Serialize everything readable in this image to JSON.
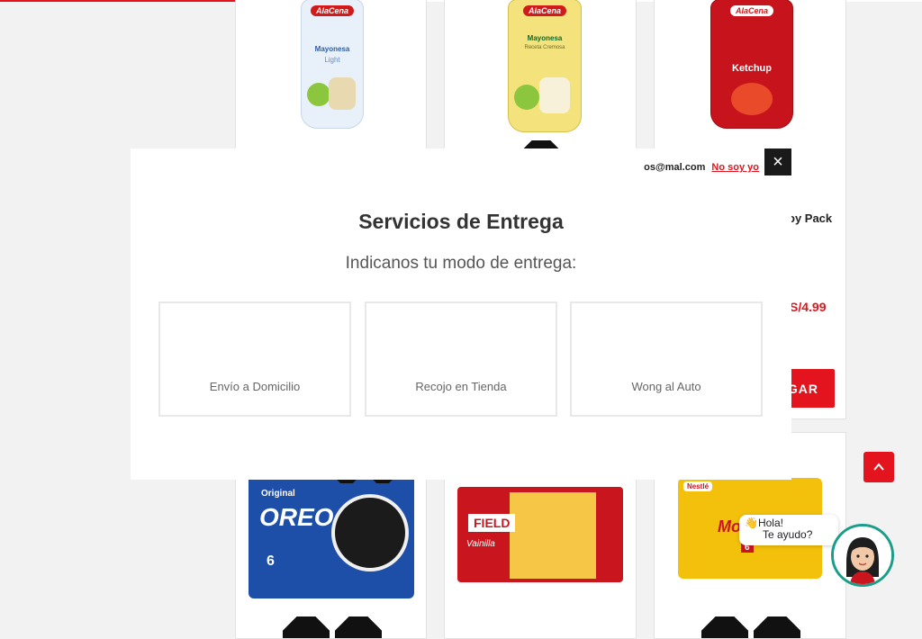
{
  "topbar": {
    "progress_fraction": 0.3
  },
  "products_row1": [
    {
      "brand": "AlaCena",
      "name": "Mayonesa",
      "subname": "Light",
      "color": "#e8f0f9"
    },
    {
      "brand": "AlaCena",
      "name": "Mayonesa",
      "subname": "Receta Cremosa",
      "color": "#f4e27c"
    },
    {
      "brand": "AlaCena",
      "name": "Ketchup",
      "title_partial": "oy Pack",
      "price": "S/4.99",
      "add_label": "GAR",
      "color": "#c7131b"
    }
  ],
  "products_row2": [
    {
      "brand": "OREO",
      "label": "Original",
      "count": "6",
      "color": "#1d4fa8"
    },
    {
      "brand": "FIELD",
      "label": "Vainilla",
      "color": "#c9161e"
    },
    {
      "brand": "Nestlé",
      "label": "Morochas",
      "count": "6",
      "color": "#f3c10b"
    }
  ],
  "modal": {
    "email": "os@mal.com",
    "not_me": "No soy yo",
    "close_icon": "close-icon",
    "title": "Servicios de Entrega",
    "subtitle": "Indicanos tu modo de entrega:",
    "options": [
      {
        "label": "Envío a Domicilio"
      },
      {
        "label": "Recojo en Tienda"
      },
      {
        "label": "Wong al Auto"
      }
    ]
  },
  "chat": {
    "greeting": "👋Hola!",
    "help": "Te ayudo?"
  },
  "colors": {
    "accent": "#e3141d",
    "dark": "#1a1a1a",
    "teal": "#1a9e8a"
  }
}
